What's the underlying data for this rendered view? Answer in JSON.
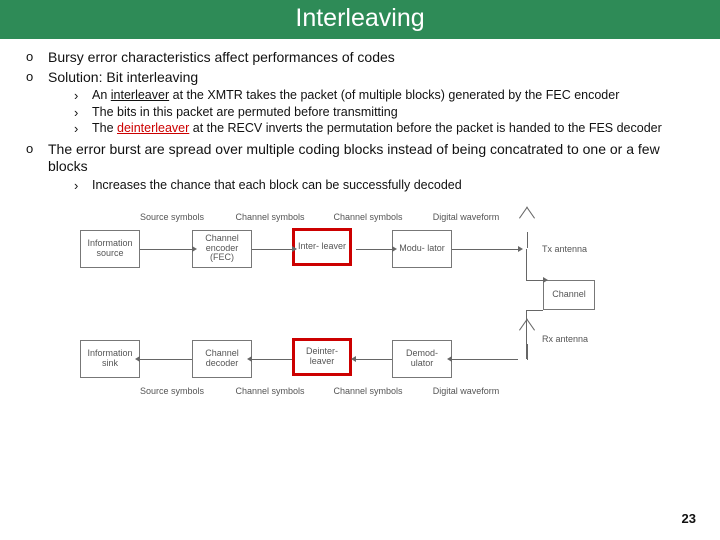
{
  "title": "Interleaving",
  "bullets": {
    "b1": "Bursy error characteristics affect performances of codes",
    "b2": "Solution: Bit interleaving",
    "b2_sub": {
      "s1_pre": "An ",
      "s1_u": "interleaver",
      "s1_post": " at the XMTR takes the packet (of multiple blocks) generated by the FEC encoder",
      "s2": "The bits in this packet are permuted before transmitting",
      "s3_pre": "The ",
      "s3_red": "deinterleaver",
      "s3_post": " at the RECV inverts the permutation before the packet is handed to the FES decoder"
    },
    "b3": "The error burst are spread over multiple coding blocks instead of being concatrated to one or a few blocks",
    "b3_sub": {
      "s1": "Increases the chance that each block can be successfully decoded"
    }
  },
  "diagram": {
    "labels_top": {
      "l1": "Source symbols",
      "l2": "Channel symbols",
      "l3": "Channel symbols",
      "l4": "Digital waveform"
    },
    "labels_bottom": {
      "l1": "Source symbols",
      "l2": "Channel symbols",
      "l3": "Channel symbols",
      "l4": "Digital waveform"
    },
    "blocks": {
      "src": "Information source",
      "enc": "Channel encoder (FEC)",
      "inter": "Inter- leaver",
      "mod": "Modu- lator",
      "tx": "Tx antenna",
      "chan": "Channel",
      "rx": "Rx antenna",
      "sink": "Information sink",
      "dec": "Channel decoder",
      "deinter": "Deinter- leaver",
      "demod": "Demod- ulator"
    }
  },
  "page": "23"
}
